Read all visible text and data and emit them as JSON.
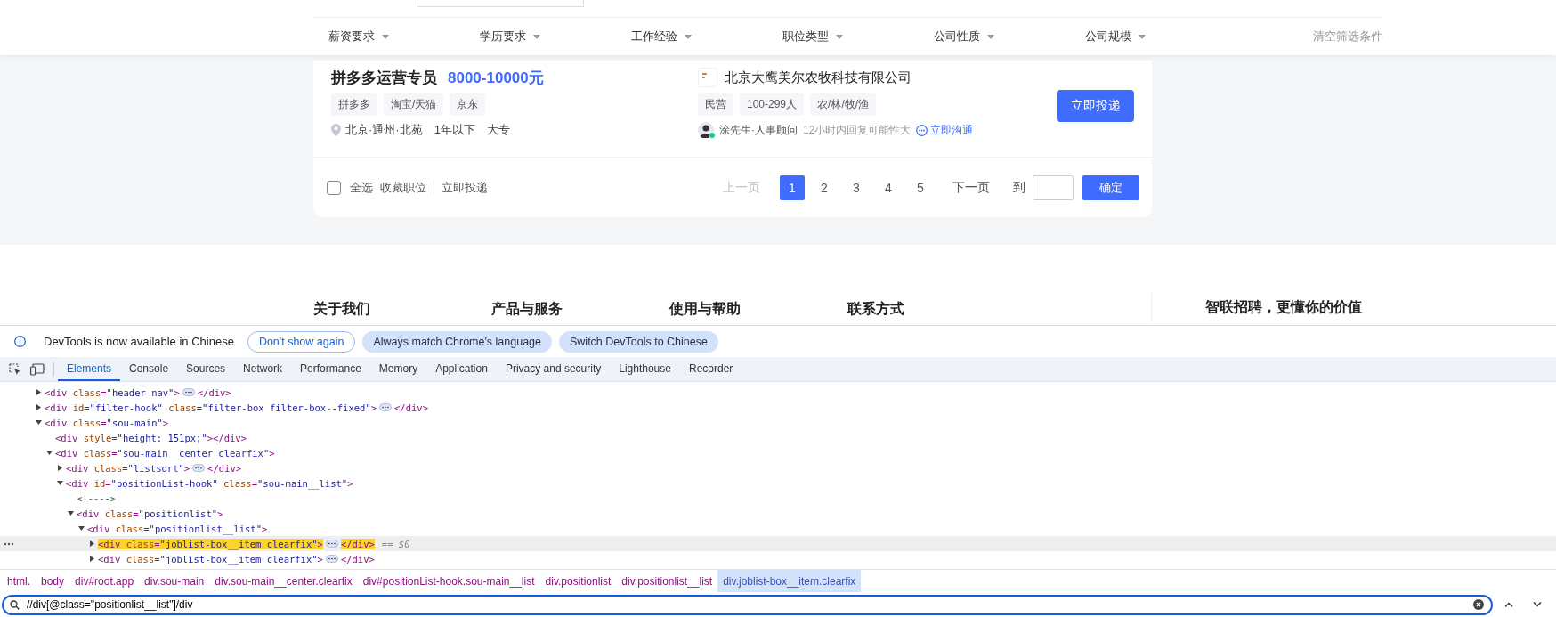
{
  "filter_bar": {
    "filters": [
      {
        "label": "薪资要求"
      },
      {
        "label": "学历要求"
      },
      {
        "label": "工作经验"
      },
      {
        "label": "职位类型"
      },
      {
        "label": "公司性质"
      },
      {
        "label": "公司规模"
      }
    ],
    "clear_link": "清空筛选条件"
  },
  "job_card": {
    "title": "拼多多运营专员",
    "salary": "8000-10000元",
    "tags": [
      "拼多多",
      "淘宝/天猫",
      "京东"
    ],
    "location": "北京·通州·北苑",
    "experience": "1年以下",
    "education": "大专",
    "company": "北京大鹰美尔农牧科技有限公司",
    "company_tags": [
      "民营",
      "100-299人",
      "农/林/牧/渔"
    ],
    "recruiter": "涂先生·人事顾问",
    "online": true,
    "reply_hint": "12小时内回复可能性大",
    "chat_link": "立即沟通",
    "apply_button": "立即投递"
  },
  "list_footer": {
    "select_all": {
      "label": "全选",
      "checked": false
    },
    "actions": [
      "收藏职位",
      "立即投递"
    ],
    "pagination": {
      "prev": {
        "label": "上一页",
        "disabled": true
      },
      "pages": [
        {
          "label": "1",
          "selected": true
        },
        {
          "label": "2",
          "selected": false
        },
        {
          "label": "3",
          "selected": false
        },
        {
          "label": "4",
          "selected": false
        },
        {
          "label": "5",
          "selected": false
        }
      ],
      "next": {
        "label": "下一页",
        "disabled": false
      },
      "goto_label": "到",
      "confirm": "确定"
    }
  },
  "site_footer": {
    "columns": [
      "关于我们",
      "产品与服务",
      "使用与帮助",
      "联系方式"
    ],
    "slogan": "智联招聘，更懂你的价值"
  },
  "devtools": {
    "infobar": {
      "message": "DevTools is now available in Chinese",
      "buttons": [
        {
          "label": "Don't show again",
          "kind": "outline"
        },
        {
          "label": "Always match Chrome's language",
          "kind": "filled"
        },
        {
          "label": "Switch DevTools to Chinese",
          "kind": "filled"
        }
      ]
    },
    "tabs": [
      {
        "label": "Elements",
        "selected": true
      },
      {
        "label": "Console",
        "selected": false
      },
      {
        "label": "Sources",
        "selected": false
      },
      {
        "label": "Network",
        "selected": false
      },
      {
        "label": "Performance",
        "selected": false
      },
      {
        "label": "Memory",
        "selected": false
      },
      {
        "label": "Application",
        "selected": false
      },
      {
        "label": "Privacy and security",
        "selected": false
      },
      {
        "label": "Lighthouse",
        "selected": false
      },
      {
        "label": "Recorder",
        "selected": false
      }
    ],
    "tree": [
      {
        "kind": "element",
        "open": "<div class=\"header-nav\">",
        "close": "</div>",
        "expanded": false,
        "selected": false
      },
      {
        "kind": "element",
        "open": "<div id=\"filter-hook\" class=\"filter-box filter-box--fixed\">",
        "close": "</div>",
        "expanded": false,
        "selected": false
      },
      {
        "kind": "element",
        "open": "<div class=\"sou-main\">",
        "expanded": true,
        "selected": false,
        "children": [
          {
            "kind": "leaf",
            "open": "<div style=\"height: 151px;\">",
            "close": "</div>",
            "selected": false
          },
          {
            "kind": "element",
            "open": "<div class=\"sou-main__center clearfix\">",
            "expanded": true,
            "selected": false,
            "children": [
              {
                "kind": "element",
                "open": "<div class=\"listsort\">",
                "close": "</div>",
                "expanded": false,
                "selected": false
              },
              {
                "kind": "element",
                "open": "<div id=\"positionList-hook\" class=\"sou-main__list\">",
                "expanded": true,
                "selected": false,
                "children": [
                  {
                    "kind": "comment",
                    "open": "<!---->",
                    "selected": false
                  },
                  {
                    "kind": "element",
                    "open": "<div class=\"positionlist\">",
                    "expanded": true,
                    "selected": false,
                    "children": [
                      {
                        "kind": "element",
                        "open": "<div class=\"positionlist__list\">",
                        "expanded": true,
                        "selected": false,
                        "children": [
                          {
                            "kind": "element",
                            "open": "<div class=\"joblist-box__item clearfix\">",
                            "close": "</div>",
                            "expanded": false,
                            "selected": true,
                            "highlighted": true,
                            "console_ref": "== $0"
                          },
                          {
                            "kind": "element",
                            "open": "<div class=\"joblist-box__item clearfix\">",
                            "close": "</div>",
                            "expanded": false,
                            "selected": false
                          }
                        ]
                      }
                    ]
                  }
                ]
              }
            ]
          }
        ]
      }
    ],
    "breadcrumbs": [
      {
        "label": "html.",
        "selected": false
      },
      {
        "label": "body",
        "selected": false
      },
      {
        "label": "div#root.app",
        "selected": false
      },
      {
        "label": "div.sou-main",
        "selected": false
      },
      {
        "label": "div.sou-main__center.clearfix",
        "selected": false
      },
      {
        "label": "div#positionList-hook.sou-main__list",
        "selected": false
      },
      {
        "label": "div.positionlist",
        "selected": false
      },
      {
        "label": "div.positionlist__list",
        "selected": false
      },
      {
        "label": "div.joblist-box__item.clearfix",
        "selected": true
      }
    ],
    "search": {
      "value": "//div[@class=\"positionlist__list\"]/div"
    }
  }
}
